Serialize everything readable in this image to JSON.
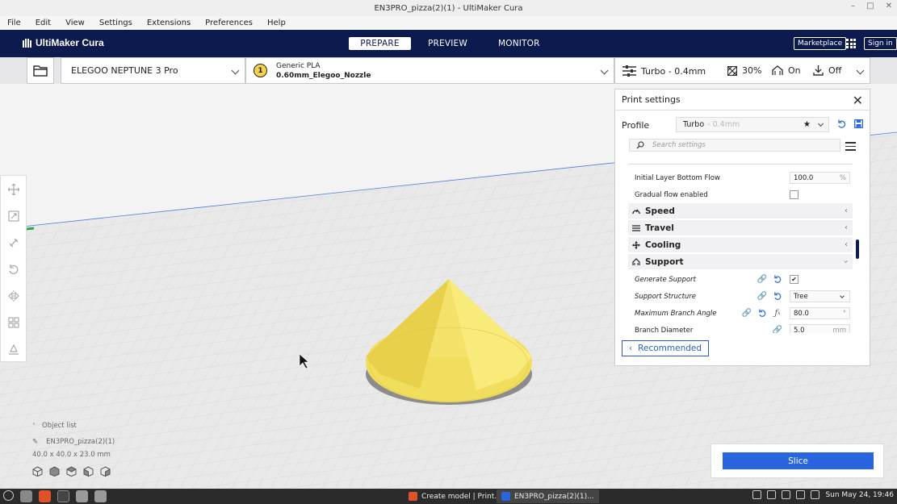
{
  "window": {
    "title": "EN3PRO_pizza(2)(1) - UltiMaker Cura"
  },
  "menu": [
    "File",
    "Edit",
    "View",
    "Settings",
    "Extensions",
    "Preferences",
    "Help"
  ],
  "header": {
    "logo": "UltiMaker Cura",
    "tabs": [
      "PREPARE",
      "PREVIEW",
      "MONITOR"
    ],
    "marketplace": "Marketplace",
    "signin": "Sign in"
  },
  "toolbar": {
    "printer": "ELEGOO NEPTUNE 3 Pro",
    "extruder_number": "1",
    "material": "Generic PLA",
    "nozzle": "0.60mm_Elegoo_Nozzle",
    "profile": "Turbo - 0.4mm",
    "infill": "30%",
    "support": "On",
    "adhesion": "Off"
  },
  "panel": {
    "title": "Print settings",
    "profile_label": "Profile",
    "profile_name": "Turbo",
    "profile_sub": "- 0.4mm",
    "search_placeholder": "Search settings",
    "rows": {
      "initial_layer_bottom_flow": {
        "label": "Initial Layer Bottom Flow",
        "value": "100.0",
        "unit": "%"
      },
      "gradual_flow": {
        "label": "Gradual flow enabled"
      },
      "speed": "Speed",
      "travel": "Travel",
      "cooling": "Cooling",
      "support": "Support",
      "generate_support": {
        "label": "Generate Support",
        "checked": "✔"
      },
      "support_structure": {
        "label": "Support Structure",
        "value": "Tree"
      },
      "max_branch_angle": {
        "label": "Maximum Branch Angle",
        "value": "80.0",
        "unit": "°"
      },
      "branch_diameter": {
        "label": "Branch Diameter",
        "value": "5.0",
        "unit": "mm"
      }
    },
    "recommended": "Recommended"
  },
  "object_list": {
    "title": "Object list",
    "name": "EN3PRO_pizza(2)(1)",
    "dimensions": "40.0 x 40.0 x 23.0 mm"
  },
  "slice": {
    "label": "Slice"
  },
  "taskbar": {
    "task1": "Create model | Print...",
    "task2": "EN3PRO_pizza(2)(1)...",
    "clock": "Sun May 24, 19:46"
  },
  "colors": {
    "header": "#0d1a4d",
    "accent": "#2a65e0",
    "model": "#f5e26a"
  }
}
